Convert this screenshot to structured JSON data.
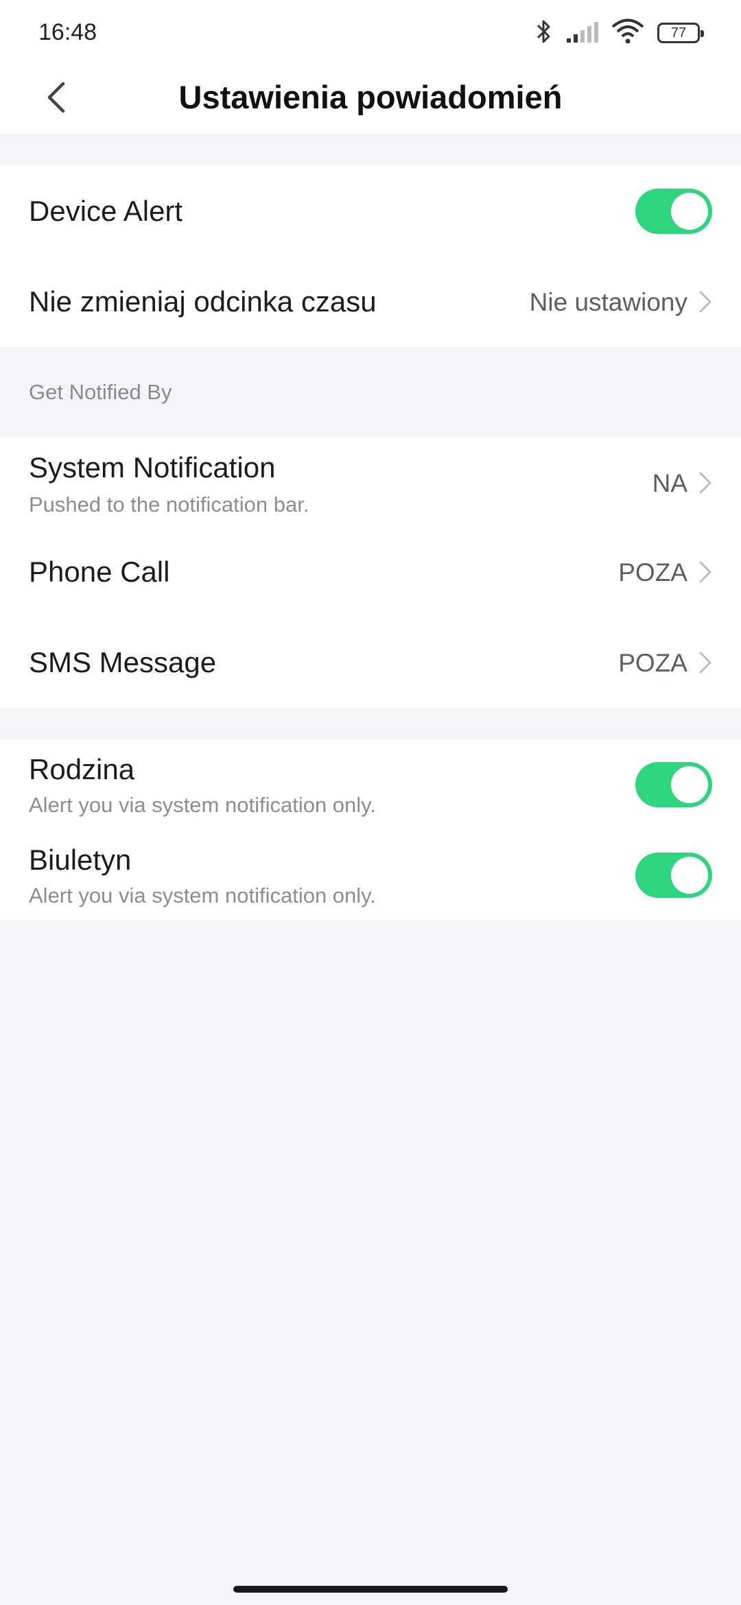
{
  "status_bar": {
    "time": "16:48",
    "battery": "77",
    "icons": [
      "bluetooth-icon",
      "signal-icon",
      "wifi-icon",
      "battery-icon"
    ]
  },
  "header": {
    "title": "Ustawienia powiadomień",
    "back_icon": "chevron-left-icon"
  },
  "section1": {
    "device_alert": {
      "label": "Device Alert",
      "enabled": true
    },
    "time_period": {
      "label": "Nie zmieniaj odcinka czasu",
      "value": "Nie ustawiony"
    }
  },
  "notified_by": {
    "header": "Get Notified By",
    "system_notification": {
      "label": "System Notification",
      "sub": "Pushed to the notification bar.",
      "value": "NA"
    },
    "phone_call": {
      "label": "Phone Call",
      "value": "POZA"
    },
    "sms_message": {
      "label": "SMS Message",
      "value": "POZA"
    }
  },
  "section3": {
    "rodzina": {
      "label": "Rodzina",
      "sub": "Alert you via system notification only.",
      "enabled": true
    },
    "biuletyn": {
      "label": "Biuletyn",
      "sub": "Alert you via system notification only.",
      "enabled": true
    }
  },
  "colors": {
    "toggle_on": "#2fd47f",
    "background": "#f4f5f9",
    "card": "#ffffff"
  }
}
